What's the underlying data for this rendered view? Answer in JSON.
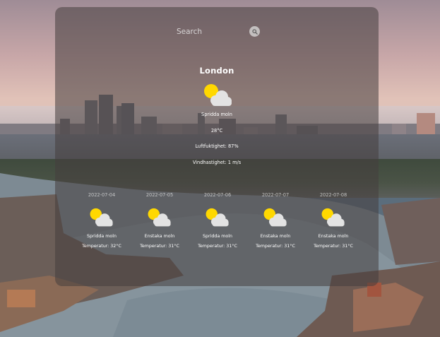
{
  "search": {
    "placeholder": "Search"
  },
  "current": {
    "city": "London",
    "icon": "sun-behind-cloud-icon",
    "description": "Spridda moln",
    "temperature": "28°C",
    "humidity": "Luftfuktighet: 87%",
    "wind": "Vindhastighet: 1 m/s"
  },
  "forecast": [
    {
      "date": "2022-07-04",
      "icon": "sun-behind-cloud-icon",
      "description": "Spridda moln",
      "temperature": "Temperatur: 32°C"
    },
    {
      "date": "2022-07-05",
      "icon": "sun-behind-cloud-icon",
      "description": "Enstaka moln",
      "temperature": "Temperatur: 31°C"
    },
    {
      "date": "2022-07-06",
      "icon": "sun-behind-cloud-icon",
      "description": "Spridda moln",
      "temperature": "Temperatur: 31°C"
    },
    {
      "date": "2022-07-07",
      "icon": "sun-behind-cloud-icon",
      "description": "Enstaka moln",
      "temperature": "Temperatur: 31°C"
    },
    {
      "date": "2022-07-08",
      "icon": "sun-behind-cloud-icon",
      "description": "Enstaka moln",
      "temperature": "Temperatur: 31°C"
    }
  ],
  "colors": {
    "sun": "#ffd800",
    "cloud": "#e3e3e3",
    "panel": "#463e3e"
  }
}
